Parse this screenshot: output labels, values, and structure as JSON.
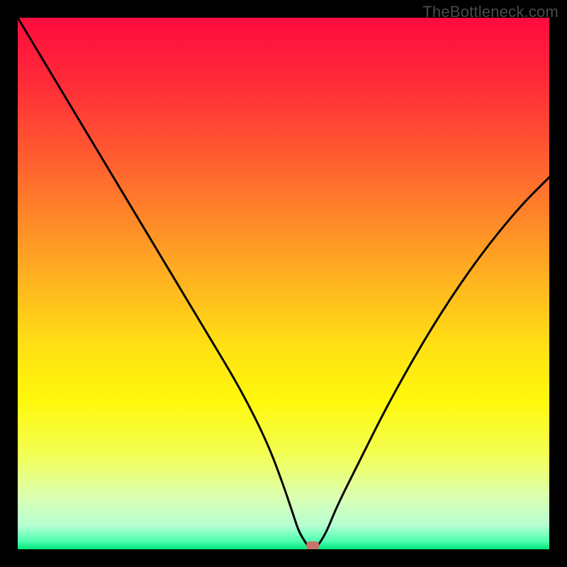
{
  "watermark": "TheBottleneck.com",
  "chart_data": {
    "type": "line",
    "title": "",
    "xlabel": "",
    "ylabel": "",
    "xlim": [
      0,
      100
    ],
    "ylim": [
      0,
      100
    ],
    "grid": false,
    "gradient_stops": [
      {
        "offset": 0,
        "color": "#ff0b3e"
      },
      {
        "offset": 0.12,
        "color": "#ff2a39"
      },
      {
        "offset": 0.3,
        "color": "#ff6a2e"
      },
      {
        "offset": 0.48,
        "color": "#ffae21"
      },
      {
        "offset": 0.62,
        "color": "#ffe114"
      },
      {
        "offset": 0.72,
        "color": "#fff80b"
      },
      {
        "offset": 0.82,
        "color": "#f3ff52"
      },
      {
        "offset": 0.9,
        "color": "#dcffb0"
      },
      {
        "offset": 0.955,
        "color": "#b6ffd3"
      },
      {
        "offset": 0.985,
        "color": "#4dffb0"
      },
      {
        "offset": 1.0,
        "color": "#00e47a"
      }
    ],
    "series": [
      {
        "name": "bottleneck-curve",
        "x": [
          0,
          6,
          12,
          18,
          24,
          30,
          36,
          42,
          47,
          50,
          52,
          53,
          55,
          56,
          58,
          60,
          64,
          70,
          78,
          86,
          94,
          100
        ],
        "values": [
          100,
          90,
          80,
          70,
          60,
          50,
          40,
          30,
          20,
          12,
          6,
          3,
          0,
          0,
          3,
          8,
          16,
          28,
          42,
          54,
          64,
          70
        ]
      }
    ],
    "annotations": [
      {
        "name": "min-marker",
        "x": 55.5,
        "y": 0.7,
        "color": "#c9746a"
      }
    ]
  }
}
